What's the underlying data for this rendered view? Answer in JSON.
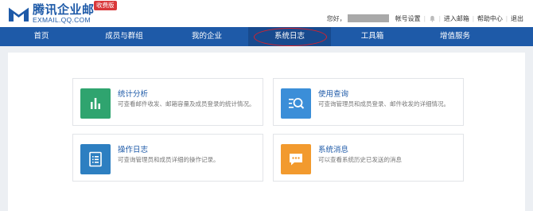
{
  "header": {
    "logo_cn": "腾讯企业邮",
    "logo_en": "EXMAIL.QQ.COM",
    "badge": "收费版",
    "greeting": "您好，",
    "links": [
      "帐号设置",
      "进入邮箱",
      "帮助中心",
      "退出"
    ]
  },
  "nav": {
    "items": [
      "首页",
      "成员与群组",
      "我的企业",
      "系统日志",
      "工具箱",
      "增值服务"
    ],
    "active": "系统日志"
  },
  "cards": [
    {
      "title": "统计分析",
      "desc": "可查看邮件收发、邮箱容量及成员登录的统计情况。",
      "icon": "bar-chart-icon",
      "color": "#2fa46f"
    },
    {
      "title": "使用查询",
      "desc": "可查询管理员和成员登录、邮件收发的详细情况。",
      "icon": "search-list-icon",
      "color": "#3b8ed8"
    },
    {
      "title": "操作日志",
      "desc": "可查询管理员和成员详细的操作记录。",
      "icon": "list-doc-icon",
      "color": "#2d7fc1"
    },
    {
      "title": "系统消息",
      "desc": "可以查看系统历史已发送的消息",
      "icon": "message-icon",
      "color": "#f29a2e"
    }
  ],
  "colors": {
    "brand": "#1e5aa8",
    "highlight_ring": "#d9212b"
  }
}
